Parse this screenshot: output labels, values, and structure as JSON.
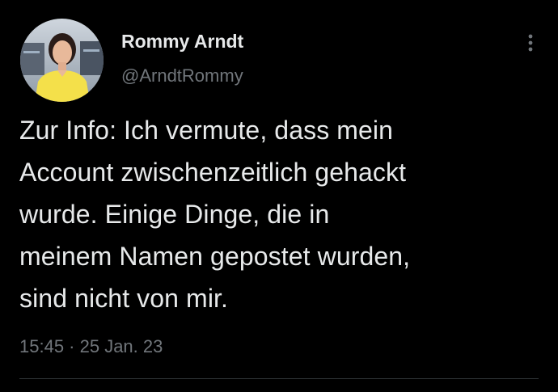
{
  "author": {
    "display_name": "Rommy Arndt",
    "handle": "@ArndtRommy",
    "avatar_icon": "profile-photo"
  },
  "tweet": {
    "lines": [
      "Zur Info: Ich vermute, dass mein",
      "Account zwischenzeitlich gehackt",
      "wurde. Einige Dinge, die in",
      "meinem Namen gepostet wurden,",
      "sind nicht von mir."
    ],
    "timestamp": "15:45 · 25 Jan. 23"
  },
  "controls": {
    "more_icon": "more-vertical-icon"
  },
  "colors": {
    "background": "#000000",
    "primary_text": "#e7e9ea",
    "secondary_text": "#71767b",
    "divider": "#2f3336"
  }
}
